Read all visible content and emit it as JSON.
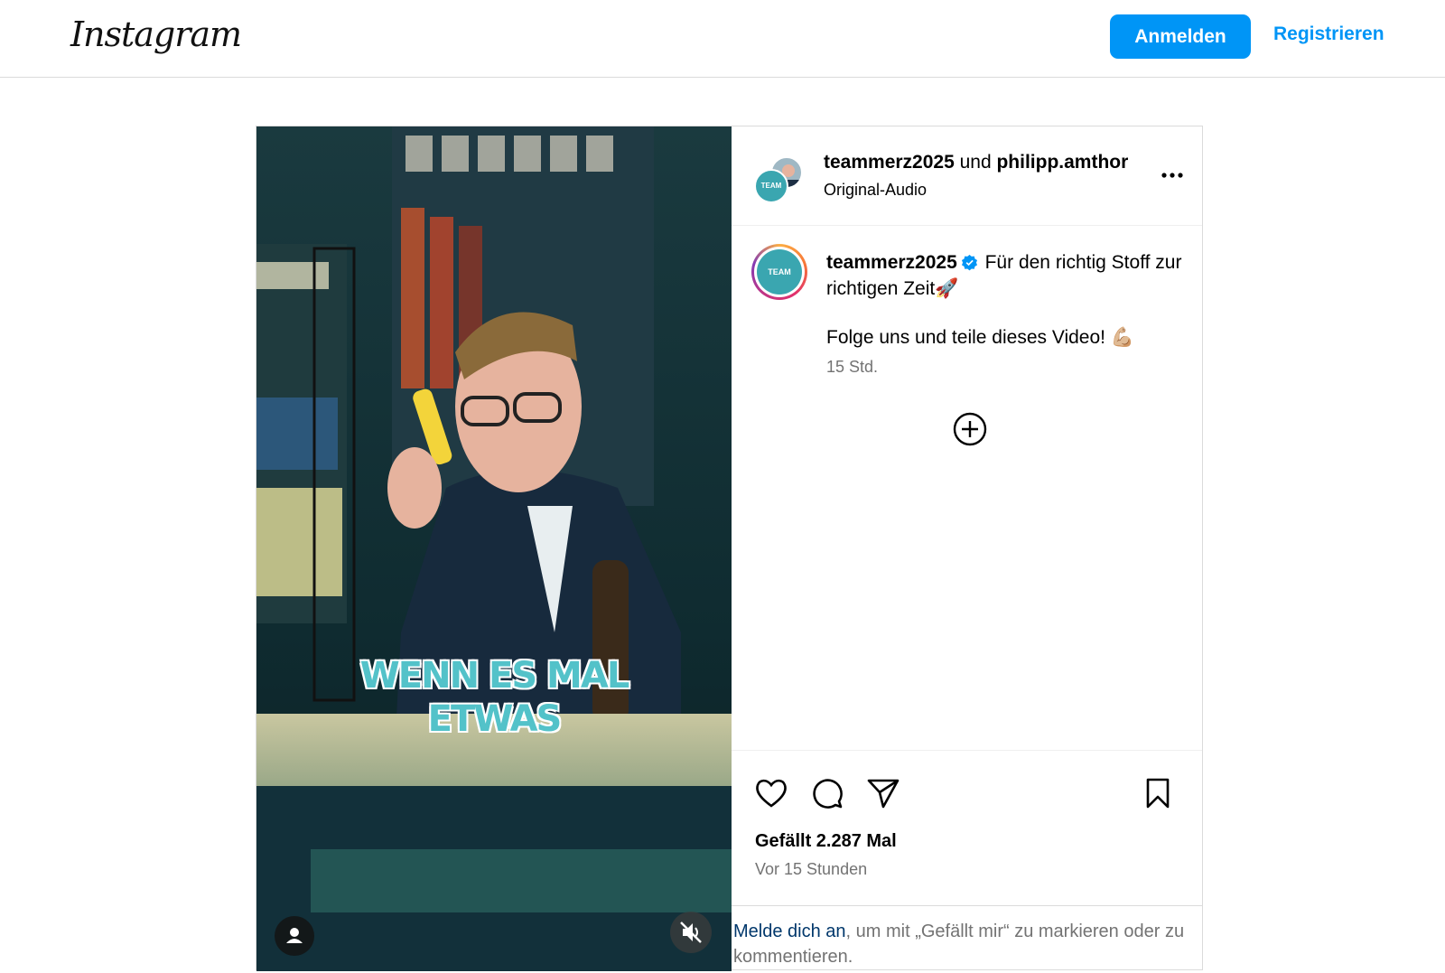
{
  "header": {
    "logo_text": "Instagram",
    "login_label": "Anmelden",
    "register_label": "Registrieren"
  },
  "media": {
    "overlay_line1": "WENN ES MAL",
    "overlay_line2": "ETWAS"
  },
  "post_header": {
    "author": "teammerz2025",
    "connector": " und ",
    "collaborator": "philipp.amthor",
    "audio": "Original-Audio"
  },
  "caption": {
    "username": "teammerz2025",
    "text": "Für den richtig Stoff zur richtigen Zeit🚀",
    "line2": "Folge uns und teile dieses Video! 💪🏼",
    "time": "15 Std."
  },
  "engagement": {
    "likes": "Gefällt 2.287 Mal",
    "posted": "Vor 15 Stunden"
  },
  "login_prompt": {
    "link": "Melde dich an",
    "rest": ", um mit „Gefällt mir“ zu markieren oder zu kommentieren."
  },
  "colors": {
    "accent_blue": "#0095f6",
    "verified_blue": "#0095f6",
    "overlay_teal": "#53c2c9",
    "secondary_text": "#737373"
  },
  "icons": [
    "more-icon",
    "verified-icon",
    "add-circle-icon",
    "heart-icon",
    "comment-icon",
    "share-icon",
    "bookmark-icon",
    "user-tag-icon",
    "mute-icon"
  ]
}
